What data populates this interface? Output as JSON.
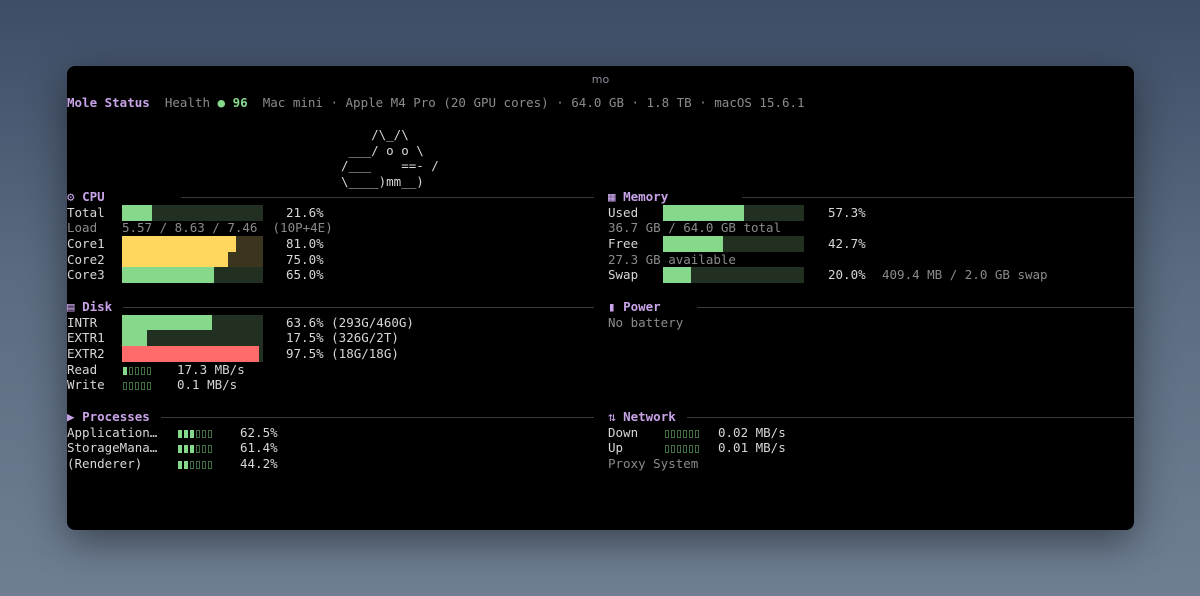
{
  "window": {
    "title": "mo"
  },
  "header": {
    "app": "Mole Status",
    "health_label": "Health",
    "health_dot": "●",
    "health_value": "96",
    "system_info": "Mac mini · Apple M4 Pro (20 GPU cores) · 64.0 GB · 1.8 TB · macOS 15.6.1"
  },
  "mascot": [
    "    /\\_/\\",
    " ___/ o o \\",
    "/___    ==- /",
    "\\____)mm__)"
  ],
  "cpu": {
    "icon": "⚙",
    "title": "CPU",
    "rows": [
      {
        "label": "Total",
        "value": "21.6%",
        "fraction": 0.216,
        "color": "#86d98a"
      },
      {
        "label": "Core1",
        "value": "81.0%",
        "fraction": 0.81,
        "color": "#ffd75f"
      },
      {
        "label": "Core2",
        "value": "75.0%",
        "fraction": 0.75,
        "color": "#ffd75f"
      },
      {
        "label": "Core3",
        "value": "65.0%",
        "fraction": 0.65,
        "color": "#86d98a"
      }
    ],
    "load_label": "Load",
    "load_value": "5.57 / 8.63 / 7.46  (10P+4E)"
  },
  "memory": {
    "icon": "▦",
    "title": "Memory",
    "used_label": "Used",
    "used_value": "57.3%",
    "used_fraction": 0.573,
    "used_detail": "36.7 GB / 64.0 GB total",
    "free_label": "Free",
    "free_value": "42.7%",
    "free_fraction": 0.427,
    "free_detail": "27.3 GB available",
    "swap_label": "Swap",
    "swap_value": "20.0%",
    "swap_fraction": 0.2,
    "swap_detail": "409.4 MB / 2.0 GB swap"
  },
  "disk": {
    "icon": "▤",
    "title": "Disk",
    "rows": [
      {
        "label": "INTR",
        "value": "63.6% (293G/460G)",
        "fraction": 0.636,
        "color": "#86d98a"
      },
      {
        "label": "EXTR1",
        "value": "17.5% (326G/2T)",
        "fraction": 0.175,
        "color": "#86d98a"
      },
      {
        "label": "EXTR2",
        "value": "97.5% (18G/18G)",
        "fraction": 0.975,
        "color": "#ff6b6b"
      }
    ],
    "read_label": "Read",
    "read_value": "17.3 MB/s",
    "read_level": 1,
    "write_label": "Write",
    "write_value": "0.1 MB/s",
    "write_level": 0
  },
  "power": {
    "icon": "▮",
    "title": "Power",
    "status": "No battery"
  },
  "processes": {
    "icon": "▶",
    "title": "Processes",
    "rows": [
      {
        "name": "Application…",
        "value": "62.5%",
        "level": 3
      },
      {
        "name": "StorageMana…",
        "value": "61.4%",
        "level": 3
      },
      {
        "name": "(Renderer)",
        "value": "44.2%",
        "level": 2
      }
    ]
  },
  "network": {
    "icon": "⇅",
    "title": "Network",
    "down_label": "Down",
    "down_value": "0.02 MB/s",
    "up_label": "Up",
    "up_value": "0.01 MB/s",
    "proxy": "Proxy System"
  }
}
